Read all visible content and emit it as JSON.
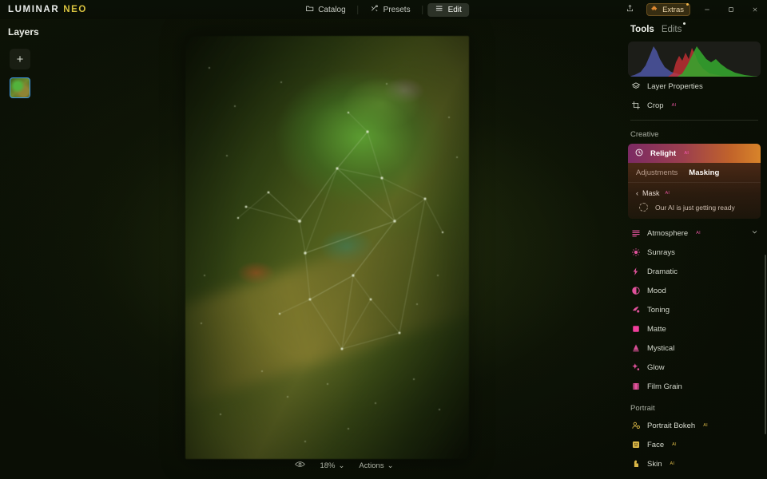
{
  "app": {
    "logo_main": "LUMINAR",
    "logo_accent": "NEO"
  },
  "titlebar": {
    "nav": [
      {
        "label": "Catalog",
        "icon": "folder-icon",
        "active": false
      },
      {
        "label": "Presets",
        "icon": "presets-icon",
        "active": false
      },
      {
        "label": "Edit",
        "icon": "sliders-icon",
        "active": true
      }
    ],
    "share_icon": "share-export-icon",
    "extras": {
      "label": "Extras",
      "icon": "puzzle-icon",
      "badge": "•"
    },
    "window_controls": [
      {
        "name": "minimize-button",
        "glyph": "–"
      },
      {
        "name": "maximize-button",
        "glyph": "❐"
      },
      {
        "name": "close-button",
        "glyph": "✕"
      }
    ]
  },
  "layers": {
    "title": "Layers",
    "add_label": "+",
    "items": [
      {
        "name": "layer-thumbnail",
        "selected": true
      }
    ]
  },
  "canvas": {
    "visibility_icon": "eye-icon",
    "zoom_level": "18%",
    "zoom_chevron": "⌄",
    "actions_label": "Actions",
    "actions_chevron": "⌄"
  },
  "tools_panel": {
    "tabs": [
      {
        "label": "Tools",
        "active": true
      },
      {
        "label": "Edits",
        "active": false,
        "badge": true
      }
    ],
    "histogram": {
      "name": "rgb-histogram",
      "channels": [
        "red",
        "green",
        "blue"
      ]
    },
    "top_tools": [
      {
        "label": "Layer Properties",
        "icon": "layers-icon",
        "ai": ""
      },
      {
        "label": "Crop",
        "icon": "crop-icon",
        "ai": "AI"
      }
    ],
    "sections": [
      {
        "label": "Creative",
        "items": [
          {
            "label": "Sunrays",
            "icon": "sunrays-icon",
            "ai": "",
            "color": "pink"
          },
          {
            "label": "Dramatic",
            "icon": "dramatic-icon",
            "ai": "",
            "color": "pink"
          },
          {
            "label": "Mood",
            "icon": "mood-icon",
            "ai": "",
            "color": "pink"
          },
          {
            "label": "Toning",
            "icon": "toning-icon",
            "ai": "",
            "color": "pink"
          },
          {
            "label": "Matte",
            "icon": "matte-icon",
            "ai": "",
            "color": "pink"
          },
          {
            "label": "Mystical",
            "icon": "mystical-icon",
            "ai": "",
            "color": "pink"
          },
          {
            "label": "Glow",
            "icon": "glow-icon",
            "ai": "",
            "color": "pink"
          },
          {
            "label": "Film Grain",
            "icon": "film-grain-icon",
            "ai": "",
            "color": "pink"
          }
        ]
      },
      {
        "label": "Portrait",
        "items": [
          {
            "label": "Portrait Bokeh",
            "icon": "portrait-bokeh-icon",
            "ai": "AI",
            "color": "gold"
          },
          {
            "label": "Face",
            "icon": "face-icon",
            "ai": "AI",
            "color": "gold"
          },
          {
            "label": "Skin",
            "icon": "skin-icon",
            "ai": "AI",
            "color": "gold"
          }
        ]
      }
    ],
    "active_tool": {
      "label": "Relight",
      "ai": "AI",
      "icon": "relight-icon",
      "sub_tabs": [
        {
          "label": "Adjustments",
          "active": false
        },
        {
          "label": "Masking",
          "active": true
        }
      ],
      "mask_back_chevron": "‹",
      "mask_label": "Mask",
      "mask_ai": "AI",
      "loading_text": "Our AI is just getting ready"
    },
    "atmosphere": {
      "label": "Atmosphere",
      "ai": "AI",
      "icon": "atmosphere-icon",
      "chevron": "⌄"
    }
  },
  "colors": {
    "accent_gold": "#d8c23f",
    "accent_pink": "#e0529b",
    "accent_orange": "#d8842a",
    "selection_blue": "#3d9ae8"
  }
}
